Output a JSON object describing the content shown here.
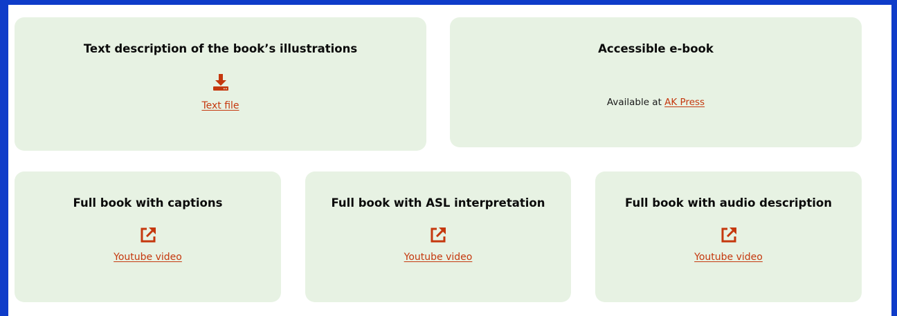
{
  "colors": {
    "frame_border": "#0f3cc9",
    "page_background": "#ffffff",
    "card_background": "#e7f2e3",
    "accent": "#c5380e",
    "title_text": "#0b0b0b"
  },
  "top_row": {
    "illustrations_card": {
      "title": "Text description of the book’s illustrations",
      "icon": "download-icon",
      "link_label": "Text file"
    },
    "ebook_card": {
      "title": "Accessible e-book",
      "available_prefix": "Available at ",
      "link_label": "AK Press"
    }
  },
  "bottom_row": {
    "captions_card": {
      "title": "Full book with captions",
      "icon": "external-link-icon",
      "link_label": "Youtube video"
    },
    "asl_card": {
      "title": "Full book with ASL interpretation",
      "icon": "external-link-icon",
      "link_label": "Youtube video"
    },
    "audio_card": {
      "title": "Full book with audio description",
      "icon": "external-link-icon",
      "link_label": "Youtube video"
    }
  }
}
